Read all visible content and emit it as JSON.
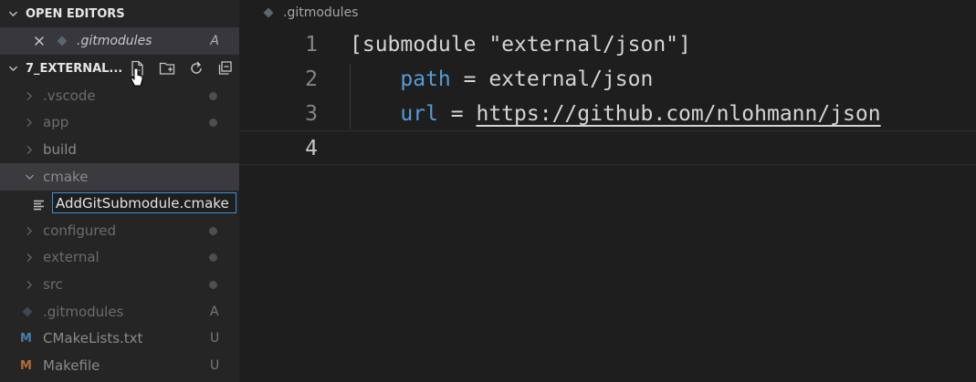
{
  "colors": {
    "sidebar_bg": "#252526",
    "editor_bg": "#1e1e1e",
    "selected_row": "#37373d",
    "focus_border": "#3c8fd8",
    "keyword": "#569cd6"
  },
  "sidebar": {
    "open_editors": {
      "title": "OPEN EDITORS",
      "items": [
        {
          "name": ".gitmodules",
          "status": "A",
          "icon": "diamond-icon"
        }
      ]
    },
    "project": {
      "title": "7_EXTERNAL...",
      "actions": [
        "new-file-icon",
        "new-folder-icon",
        "refresh-icon",
        "collapse-all-icon"
      ],
      "tree": [
        {
          "label": ".vscode",
          "type": "folder",
          "expanded": false
        },
        {
          "label": "app",
          "type": "folder",
          "expanded": false
        },
        {
          "label": "build",
          "type": "folder",
          "expanded": false
        },
        {
          "label": "cmake",
          "type": "folder",
          "expanded": true
        },
        {
          "label": "AddGitSubmodule.cmake",
          "type": "file",
          "editing": true
        },
        {
          "label": "configured",
          "type": "folder",
          "expanded": false
        },
        {
          "label": "external",
          "type": "folder",
          "expanded": false
        },
        {
          "label": "src",
          "type": "folder",
          "expanded": false
        },
        {
          "label": ".gitmodules",
          "type": "file",
          "status": "A"
        },
        {
          "label": "CMakeLists.txt",
          "type": "file",
          "status": "U"
        },
        {
          "label": "Makefile",
          "type": "file",
          "status": "U"
        }
      ]
    }
  },
  "editor": {
    "breadcrumb": ".gitmodules",
    "lines": [
      {
        "num": "1",
        "text": "[submodule \"external/json\"]"
      },
      {
        "num": "2",
        "indent": "    ",
        "key": "path",
        "op": " = ",
        "value": "external/json"
      },
      {
        "num": "3",
        "indent": "    ",
        "key": "url",
        "op": " = ",
        "value": "https://github.com/nlohmann/json"
      },
      {
        "num": "4",
        "text": ""
      }
    ]
  }
}
